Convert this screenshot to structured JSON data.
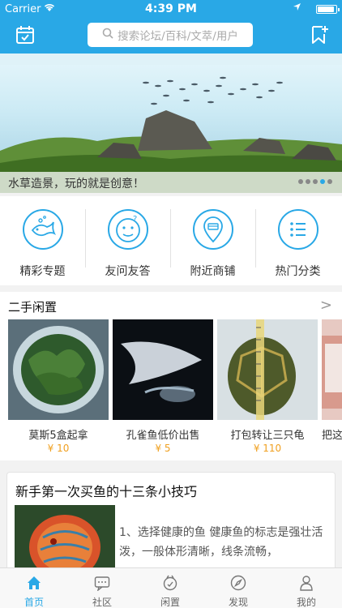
{
  "status_bar": {
    "carrier": "Carrier",
    "time": "4:39 PM",
    "battery_level": 0.9
  },
  "header": {
    "left_icon": "calendar-icon",
    "right_icon": "bookmark-add-icon",
    "search_placeholder": "搜索论坛/百科/文萃/用户",
    "accent_color": "#29a8e6"
  },
  "banner": {
    "caption": "水草造景，玩的就是创意！",
    "page_count": 5,
    "active_page": 4
  },
  "quick_menu": [
    {
      "label": "精彩专题",
      "icon": "fish-icon"
    },
    {
      "label": "友问友答",
      "icon": "smiley-question-icon"
    },
    {
      "label": "附近商铺",
      "icon": "location-shop-icon"
    },
    {
      "label": "热门分类",
      "icon": "list-icon"
    }
  ],
  "second_hand": {
    "title": "二手闲置",
    "more": ">",
    "items": [
      {
        "name": "莫斯5盒起拿",
        "price": "¥ 10"
      },
      {
        "name": "孔雀鱼低价出售",
        "price": "¥ 5"
      },
      {
        "name": "打包转让三只龟",
        "price": "¥ 110"
      },
      {
        "name": "把这",
        "price": ""
      }
    ]
  },
  "article": {
    "title": "新手第一次买鱼的十三条小技巧",
    "excerpt": "1、选择健康的鱼  健康鱼的标志是强壮活泼，一般体形清晰，线条流畅，"
  },
  "tab_bar": [
    {
      "label": "首页",
      "icon": "home-icon",
      "active": true
    },
    {
      "label": "社区",
      "icon": "chat-icon",
      "active": false
    },
    {
      "label": "闲置",
      "icon": "idle-icon",
      "active": false
    },
    {
      "label": "发现",
      "icon": "compass-icon",
      "active": false
    },
    {
      "label": "我的",
      "icon": "person-icon",
      "active": false
    }
  ]
}
